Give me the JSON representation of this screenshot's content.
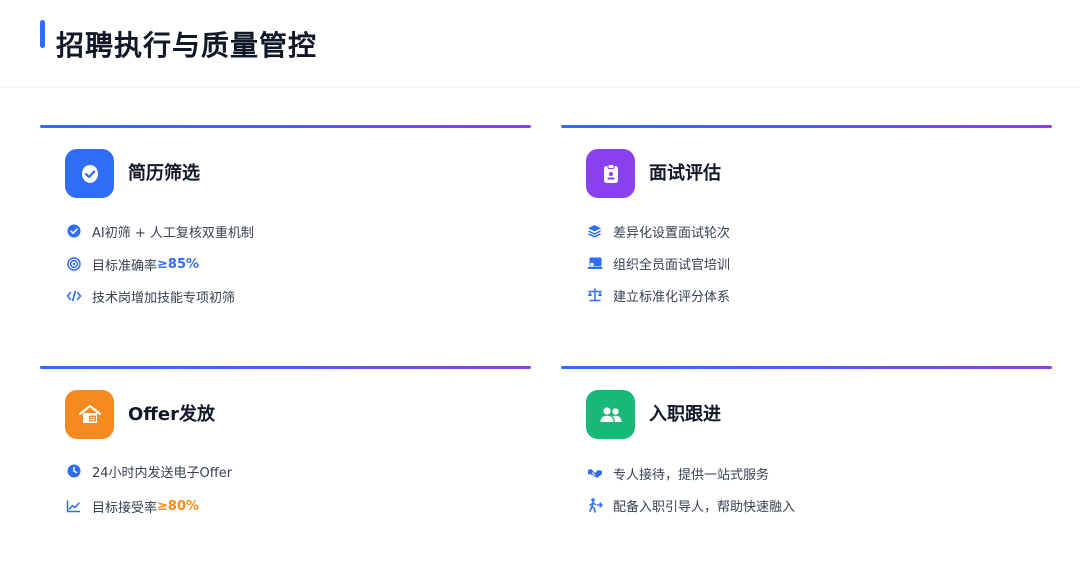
{
  "page": {
    "title": "招聘执行与质量管控"
  },
  "colors": {
    "accent_blue": "#2f6df6",
    "accent_purple": "#8b3fe0",
    "orange": "#f58a1f",
    "green": "#17b978",
    "purple": "#8a3ff0"
  },
  "cards": [
    {
      "title": "简历筛选",
      "icon": "check-badge-icon",
      "items": [
        {
          "icon": "check-circle-icon",
          "text": "AI初筛 + 人工复核双重机制",
          "highlight": ""
        },
        {
          "icon": "target-icon",
          "text": "目标准确率",
          "highlight": "≥85%"
        },
        {
          "icon": "code-icon",
          "text": "技术岗增加技能专项初筛",
          "highlight": ""
        }
      ]
    },
    {
      "title": "面试评估",
      "icon": "clipboard-icon",
      "items": [
        {
          "icon": "layers-icon",
          "text": "差异化设置面试轮次",
          "highlight": ""
        },
        {
          "icon": "training-icon",
          "text": "组织全员面试官培训",
          "highlight": ""
        },
        {
          "icon": "scale-icon",
          "text": "建立标准化评分体系",
          "highlight": ""
        }
      ]
    },
    {
      "title": "Offer发放",
      "icon": "offer-house-icon",
      "items": [
        {
          "icon": "clock-icon",
          "text": "24小时内发送电子Offer",
          "highlight": ""
        },
        {
          "icon": "trend-icon",
          "text": "目标接受率",
          "highlight": "≥80%"
        }
      ]
    },
    {
      "title": "入职跟进",
      "icon": "users-icon",
      "items": [
        {
          "icon": "handshake-icon",
          "text": "专人接待，提供一站式服务",
          "highlight": ""
        },
        {
          "icon": "walking-person-icon",
          "text": "配备入职引导人，帮助快速融入",
          "highlight": ""
        }
      ]
    }
  ]
}
